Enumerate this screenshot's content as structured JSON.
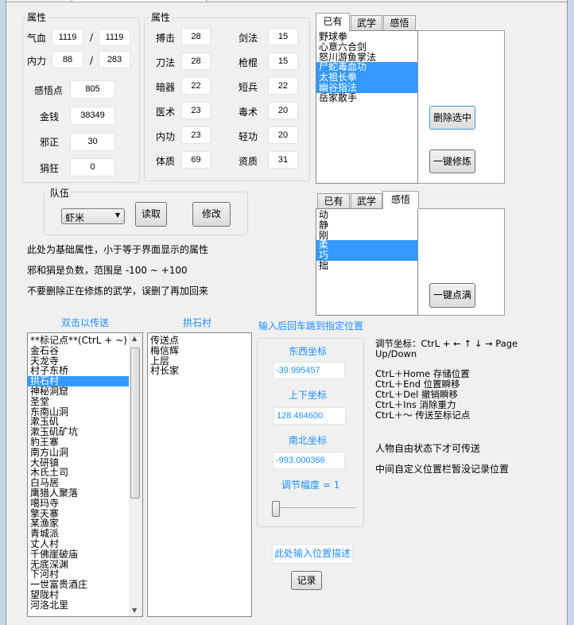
{
  "attr_group_left": {
    "title": "属性",
    "hp_label": "气血",
    "hp_cur": "1119",
    "hp_max": "1119",
    "mp_label": "内力",
    "mp_cur": "88",
    "mp_max": "283",
    "slash": "/",
    "insight_label": "感悟点",
    "insight": "805",
    "money_label": "金钱",
    "money": "38349",
    "evil_label": "邪正",
    "evil": "30",
    "wild_label": "狷狂",
    "wild": "0"
  },
  "attr_group_right": {
    "title": "属性",
    "stats": [
      {
        "label": "搏击",
        "value": "28"
      },
      {
        "label": "剑法",
        "value": "15"
      },
      {
        "label": "刀法",
        "value": "28"
      },
      {
        "label": "枪棍",
        "value": "15"
      },
      {
        "label": "暗器",
        "value": "22"
      },
      {
        "label": "短兵",
        "value": "22"
      },
      {
        "label": "医术",
        "value": "23"
      },
      {
        "label": "毒术",
        "value": "20"
      },
      {
        "label": "内功",
        "value": "23"
      },
      {
        "label": "轻功",
        "value": "20"
      },
      {
        "label": "体质",
        "value": "69"
      },
      {
        "label": "资质",
        "value": "31"
      }
    ]
  },
  "team": {
    "title": "队伍",
    "selected": "虾米",
    "read_label": "读取",
    "modify_label": "修改"
  },
  "notes": [
    "此处为基础属性，小于等于界面显示的属性",
    "邪和狷是负数，范围是 -100 ~ +100",
    "不要删除正在修炼的武学，误删了再加回来"
  ],
  "tabs_top": {
    "tabs": [
      "已有",
      "武学",
      "感悟"
    ],
    "active": 0,
    "items": [
      "野球拳",
      "心意六合剑",
      "怒川游鱼掌法",
      "尸蛇毒血功",
      "太祖长拳",
      "幽谷指法",
      "岳家散手"
    ],
    "selected": [
      3,
      4,
      5
    ],
    "delete_label": "删除选中",
    "train_label": "一键修炼"
  },
  "tabs_bottom": {
    "tabs": [
      "已有",
      "武学",
      "感悟"
    ],
    "active": 2,
    "items": [
      "动",
      "静",
      "刚",
      "柔",
      "巧",
      "拙"
    ],
    "selected": [
      3,
      4
    ],
    "fill_label": "一键点满"
  },
  "teleport": {
    "title": "双击以传送",
    "selected": 4,
    "items": [
      "**标记点**(CtrL + ~)",
      "金石谷",
      "天龙寺",
      "村子东桥",
      "拱石村",
      "神秘洞窟",
      "圣堂",
      "东南山洞",
      "漱玉矶",
      "漱玉矶矿坑",
      "豹王寨",
      "南方山洞",
      "大研镇",
      "木氏土司",
      "白马居",
      "鹰猎人聚落",
      "噶玛寺",
      "擎天寨",
      "某渔家",
      "青城派",
      "丈人村",
      "千佛崖破庙",
      "无底深渊",
      "下河村",
      "一世富贵酒庄",
      "望陇村",
      "河洛北里"
    ]
  },
  "sub_locations": {
    "title": "拱石村",
    "items": [
      "传送点",
      "梅信辉",
      "上层",
      "村长家"
    ]
  },
  "coords": {
    "hint": "输入后回车跳到指定位置",
    "ew_label": "东西坐标",
    "ew": "-39.995457",
    "ud_label": "上下坐标",
    "ud": "128.464600",
    "ns_label": "南北坐标",
    "ns": "-993.000366",
    "step_label": "调节幅度 = 1",
    "step_value": 1,
    "desc_placeholder": "此处输入位置描述",
    "record_label": "记录"
  },
  "help": {
    "line1": "调节坐标：CtrL + ← ↑ ↓ →   Page Up/Down",
    "shortcuts": [
      "CtrL＋Home 存储位置",
      "CtrL＋End  位置瞬移",
      "CtrL＋Del  撤销瞬移",
      "CtrL＋Ins  消除重力",
      "CtrL＋～  传送至标记点"
    ],
    "note1": "人物自由状态下才可传送",
    "note2": "中间自定义位置栏暂没记录位置"
  }
}
